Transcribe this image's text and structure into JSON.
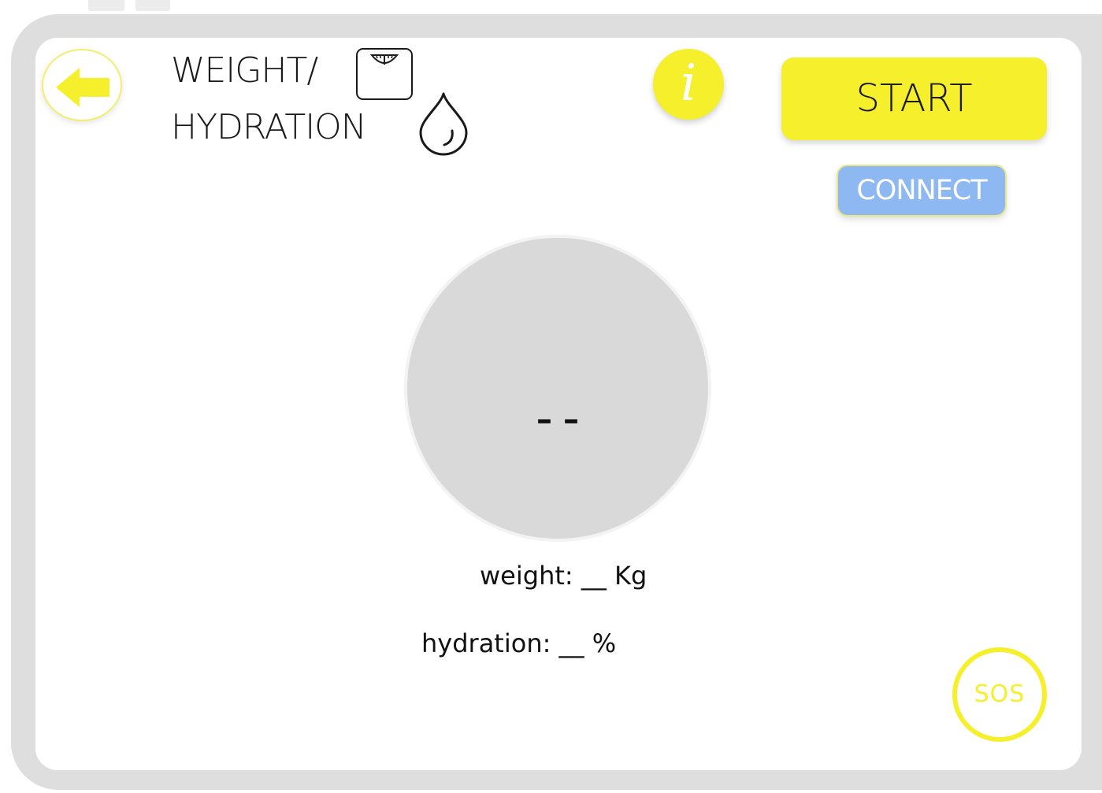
{
  "header": {
    "title_line1": "WEIGHT/",
    "title_line2": "HYDRATION"
  },
  "buttons": {
    "start_label": "START",
    "connect_label": "CONNECT",
    "info_label": "i",
    "sos_label": "SOS"
  },
  "gauge": {
    "value": "– –"
  },
  "readings": {
    "weight": "weight: __ Kg",
    "hydration": "hydration: __ %"
  },
  "icons": {
    "back": "arrow-left-icon",
    "scale": "scale-icon",
    "drop": "water-drop-icon",
    "info": "info-icon"
  },
  "colors": {
    "accent_yellow": "#f5ef2c",
    "connect_blue": "#8db8f2",
    "gauge_gray": "#d9d9d9",
    "frame_gray": "#dedede"
  }
}
